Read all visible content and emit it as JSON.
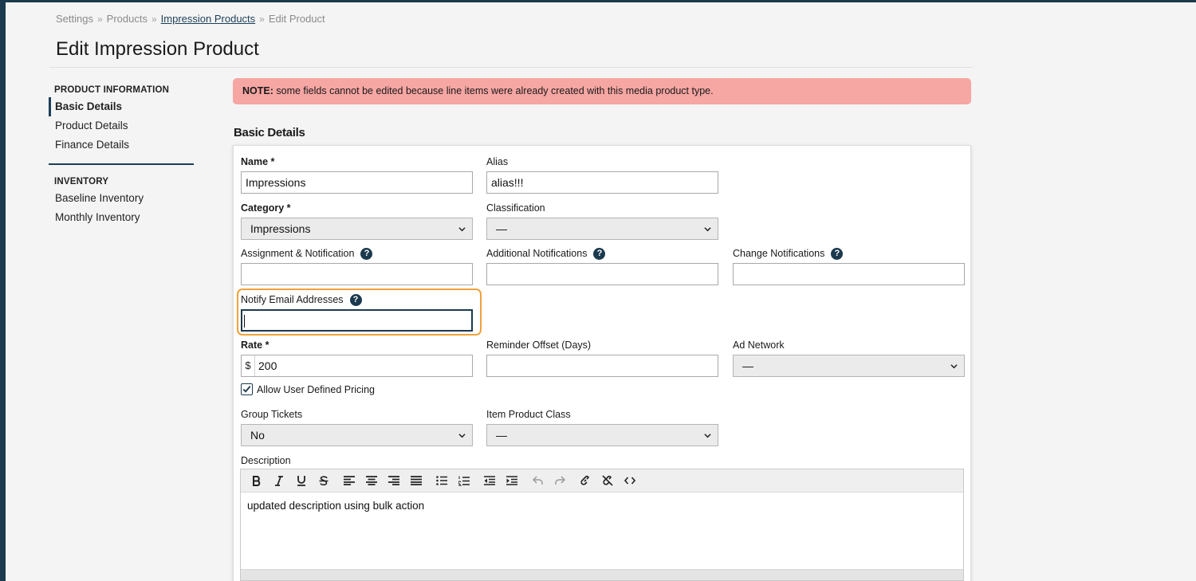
{
  "breadcrumb": {
    "items": [
      "Settings",
      "Products",
      "Impression Products",
      "Edit Product"
    ],
    "separator": "»"
  },
  "page": {
    "title": "Edit Impression Product"
  },
  "sidebar": {
    "sections": [
      {
        "heading": "PRODUCT INFORMATION",
        "items": [
          {
            "label": "Basic Details",
            "active": true
          },
          {
            "label": "Product Details",
            "active": false
          },
          {
            "label": "Finance Details",
            "active": false
          }
        ]
      },
      {
        "heading": "INVENTORY",
        "items": [
          {
            "label": "Baseline Inventory",
            "active": false
          },
          {
            "label": "Monthly Inventory",
            "active": false
          }
        ]
      }
    ]
  },
  "note": {
    "prefix": "NOTE:",
    "text": "some fields cannot be edited because line items were already created with this media product type."
  },
  "section": {
    "title": "Basic Details"
  },
  "form": {
    "name": {
      "label": "Name *",
      "value": "Impressions"
    },
    "alias": {
      "label": "Alias",
      "value": "alias!!!"
    },
    "category": {
      "label": "Category *",
      "value": "Impressions"
    },
    "classification": {
      "label": "Classification",
      "value": "—"
    },
    "assignment": {
      "label": "Assignment & Notification",
      "value": ""
    },
    "additional": {
      "label": "Additional Notifications",
      "value": ""
    },
    "change": {
      "label": "Change Notifications",
      "value": ""
    },
    "notify": {
      "label": "Notify Email Addresses",
      "value": ""
    },
    "rate": {
      "label": "Rate *",
      "prefix": "$",
      "value": "200"
    },
    "reminder": {
      "label": "Reminder Offset (Days)",
      "value": ""
    },
    "ad_network": {
      "label": "Ad Network",
      "value": "—"
    },
    "allow_pricing": {
      "label": "Allow User Defined Pricing",
      "checked": true
    },
    "group_tickets": {
      "label": "Group Tickets",
      "value": "No"
    },
    "item_class": {
      "label": "Item Product Class",
      "value": "—"
    },
    "description": {
      "label": "Description",
      "value": "updated description using bulk action"
    }
  },
  "help_icon": "?",
  "colors": {
    "accent": "#1c3a4d",
    "note_bg": "#f6a6a3",
    "focus_ring": "#f0a23a"
  }
}
